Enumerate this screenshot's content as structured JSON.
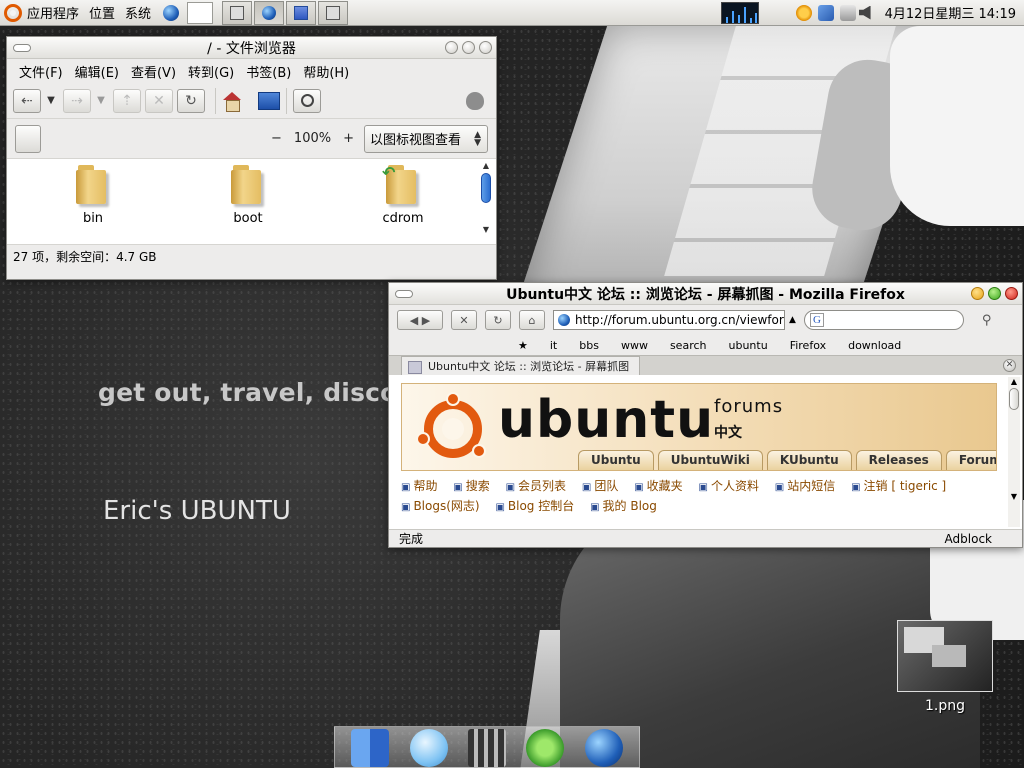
{
  "panel": {
    "menus": [
      "应用程序",
      "位置",
      "系统"
    ],
    "clock": "4月12日星期三 14:19"
  },
  "wallpaper": {
    "slogan": "get out, travel, discover.",
    "name": "Eric's UBUNTU"
  },
  "file_browser": {
    "title": "/ - 文件浏览器",
    "menu": [
      "文件(F)",
      "编辑(E)",
      "查看(V)",
      "转到(G)",
      "书签(B)",
      "帮助(H)"
    ],
    "zoom_minus": "−",
    "zoom_level": "100%",
    "zoom_plus": "+",
    "view_mode": "以图标视图查看",
    "items": [
      {
        "name": "bin"
      },
      {
        "name": "boot"
      },
      {
        "name": "cdrom"
      }
    ],
    "status": "27 项，剩余空间：4.7 GB"
  },
  "firefox": {
    "title": "Ubuntu中文 论坛 :: 浏览论坛 - 屏幕抓图 - Mozilla Firefox",
    "url": "http://forum.ubuntu.org.cn/viewforum",
    "search_placeholder": "",
    "bookmarks": [
      "★",
      "it",
      "bbs",
      "www",
      "search",
      "ubuntu",
      "Firefox",
      "download"
    ],
    "tab_title": "Ubuntu中文 论坛 :: 浏览论坛 - 屏幕抓图",
    "banner": {
      "word": "ubuntu",
      "forums": "forums",
      "cn": "中文",
      "tabs": [
        "Ubuntu",
        "UbuntuWiki",
        "KUbuntu",
        "Releases",
        "Forum(En)"
      ]
    },
    "links": [
      "帮助",
      "搜索",
      "会员列表",
      "团队",
      "收藏夹",
      "个人资料",
      "站内短信",
      "注销 [ tigeric ]",
      "Blogs(网志)",
      "Blog 控制台",
      "我的 Blog"
    ],
    "status_left": "完成",
    "status_right": "Adblock"
  },
  "desktop": {
    "file_label": "1.png"
  }
}
